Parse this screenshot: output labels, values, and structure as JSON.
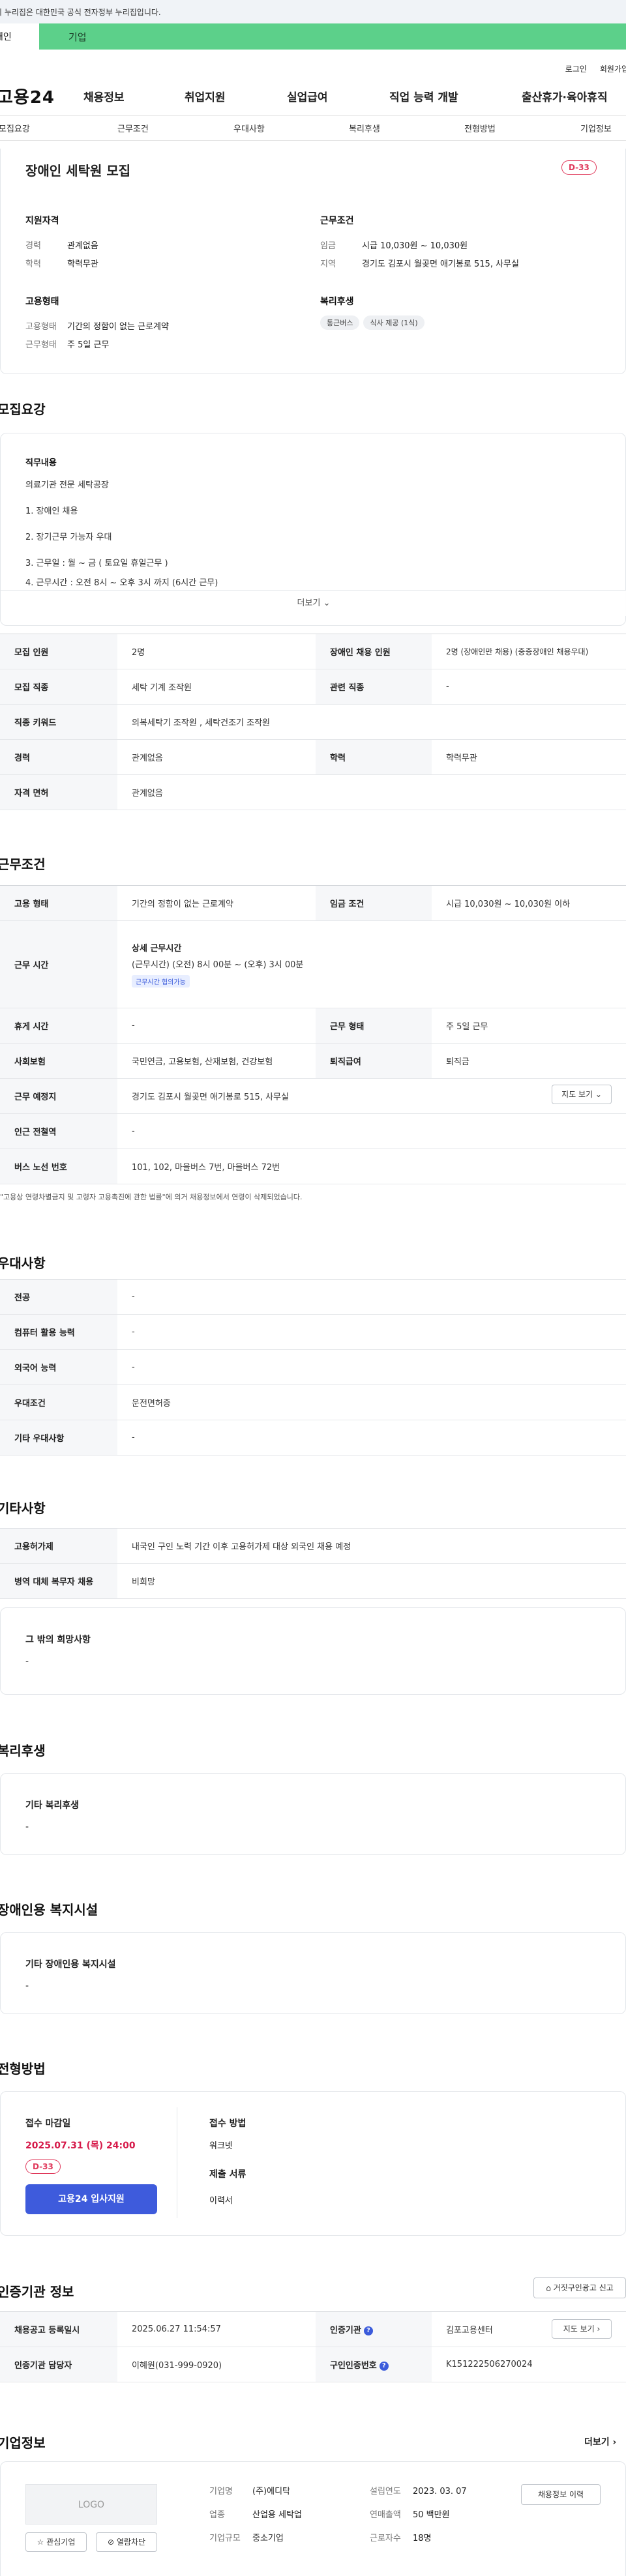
{
  "gov_banner": "이 누리집은 대한민국 공식 전자정부 누리집입니다.",
  "top_tabs": {
    "personal": "개인",
    "business": "기업"
  },
  "util": {
    "login": "로그인",
    "signup": "회원가입"
  },
  "gnb": {
    "logo": "고용24",
    "menu": [
      "채용정보",
      "취업지원",
      "실업급여",
      "직업 능력 개발",
      "출산휴가·육아휴직"
    ]
  },
  "subnav": [
    "모집요강",
    "근무조건",
    "우대사항",
    "복리후생",
    "전형방법",
    "기업정보"
  ],
  "job": {
    "title": "장애인 세탁원 모집",
    "dday": "D-33",
    "qualification": {
      "label": "지원자격",
      "rows": [
        {
          "k": "경력",
          "v": "관계없음"
        },
        {
          "k": "학력",
          "v": "학력무관"
        }
      ]
    },
    "conditions": {
      "label": "근무조건",
      "rows": [
        {
          "k": "임금",
          "v": "시급 10,030원 ~ 10,030원"
        },
        {
          "k": "지역",
          "v": "경기도 김포시 월곶면 애기봉로 515, 사무실"
        }
      ]
    },
    "employment": {
      "label": "고용형태",
      "rows": [
        {
          "k": "고용형태",
          "v": "기간의 정함이 없는 근로계약"
        },
        {
          "k": "근무형태",
          "v": "주 5일 근무"
        }
      ]
    },
    "welfare": {
      "label": "복리후생",
      "chips": [
        "통근버스",
        "식사 제공 (1식)"
      ]
    }
  },
  "recruit": {
    "title": "모집요강",
    "desc_label": "직무내용",
    "desc_lines": [
      "의료기관 전문 세탁공장",
      "1. 장애인 채용",
      "2. 장기근무 가능자 우대",
      "3. 근무일 : 월 ~ 금  ( 토요일 휴일근무 )",
      "4. 근무시간 : 오전 8시 ~ 오후 3시 까지 (6시간 근무)"
    ],
    "more": "더보기",
    "table": {
      "r1": {
        "k1": "모집 인원",
        "v1": "2명",
        "k2": "장애인 채용 인원",
        "v2": "2명 (장애인만 채용) (중증장애인 채용우대)"
      },
      "r2": {
        "k1": "모집 직종",
        "v1": "세탁 기계 조작원",
        "k2": "관련 직종",
        "v2": "-"
      },
      "r3": {
        "k": "직종 키워드",
        "v": "의복세탁기 조작원 , 세탁건조기 조작원"
      },
      "r4": {
        "k1": "경력",
        "v1": "관계없음",
        "k2": "학력",
        "v2": "학력무관"
      },
      "r5": {
        "k": "자격 면허",
        "v": "관계없음"
      }
    }
  },
  "work": {
    "title": "근무조건",
    "r1": {
      "k1": "고용 형태",
      "v1": "기간의 정함이 없는 근로계약",
      "k2": "임금 조건",
      "v2": "시급 10,030원 ~ 10,030원 이하"
    },
    "r2": {
      "k": "근무 시간",
      "sub": "상세 근무시간",
      "line": "(근무시간) (오전) 8시 00분 ~ (오후) 3시 00분",
      "badge": "근무시간 협의가능"
    },
    "r3": {
      "k1": "휴게 시간",
      "v1": "-",
      "k2": "근무 형태",
      "v2": "주 5일 근무"
    },
    "r4": {
      "k1": "사회보험",
      "v1": "국민연금, 고용보험, 산재보험, 건강보험",
      "k2": "퇴직급여",
      "v2": "퇴직금"
    },
    "r5": {
      "k": "근무 예정지",
      "v": "경기도 김포시 월곶면 애기봉로 515, 사무실",
      "btn": "지도 보기"
    },
    "r6": {
      "k": "인근 전철역",
      "v": "-"
    },
    "r7": {
      "k": "버스 노선 번호",
      "v": "101, 102, 마을버스 7번, 마을버스 72번"
    },
    "note": "\"고용상 연령차별금지 및 고령자 고용촉진에 관한 법률\"에 의거 채용정보에서 연령이 삭제되었습니다."
  },
  "pref": {
    "title": "우대사항",
    "rows": [
      {
        "k": "전공",
        "v": "-"
      },
      {
        "k": "컴퓨터 활용 능력",
        "v": "-"
      },
      {
        "k": "외국어 능력",
        "v": "-"
      },
      {
        "k": "우대조건",
        "v": "운전면허증"
      },
      {
        "k": "기타 우대사항",
        "v": "-"
      }
    ]
  },
  "etc": {
    "title": "기타사항",
    "rows": [
      {
        "k": "고용허가제",
        "v": "내국인 구인 노력 기간 이후 고용허가제 대상 외국인 채용 예정"
      },
      {
        "k": "병역 대체 복무자 채용",
        "v": "비희망"
      }
    ],
    "hope_label": "그 밖의 희망사항",
    "hope_value": "-"
  },
  "welfare": {
    "title": "복리후생",
    "label": "기타 복리후생",
    "value": "-"
  },
  "disability": {
    "title": "장애인용 복지시설",
    "label": "기타 장애인용 복지시설",
    "value": "-"
  },
  "screening": {
    "title": "전형방법",
    "deadline_label": "접수 마감일",
    "deadline": "2025.07.31 (목) 24:00",
    "dday": "D-33",
    "apply_btn": "고용24 입사지원",
    "method_label": "접수 방법",
    "method": "워크넷",
    "docs_label": "제출 서류",
    "docs": "이력서"
  },
  "cert": {
    "title": "인증기관 정보",
    "report_btn": "거짓구인광고 신고",
    "r1": {
      "k1": "채용공고 등록일시",
      "v1": "2025.06.27 11:54:57",
      "k2": "인증기관",
      "v2": "김포고용센터",
      "btn": "지도 보기"
    },
    "r2": {
      "k1": "인증기관 담당자",
      "v1": "이혜원(031-999-0920)",
      "k2": "구인인증번호",
      "v2": "K151222506270024"
    }
  },
  "company": {
    "title": "기업정보",
    "more": "더보기",
    "logo": "LOGO",
    "fav_btn": "관심기업",
    "block_btn": "열람차단",
    "history_btn": "채용정보 이력",
    "rows": [
      {
        "k1": "기업명",
        "v1": "(주)에디탁",
        "k2": "설립연도",
        "v2": "2023. 03. 07"
      },
      {
        "k1": "업종",
        "v1": "산업용 세탁업",
        "k2": "연매출액",
        "v2": "50 백만원"
      },
      {
        "k1": "기업규모",
        "v1": "중소기업",
        "k2": "근로자수",
        "v2": "18명"
      }
    ]
  }
}
